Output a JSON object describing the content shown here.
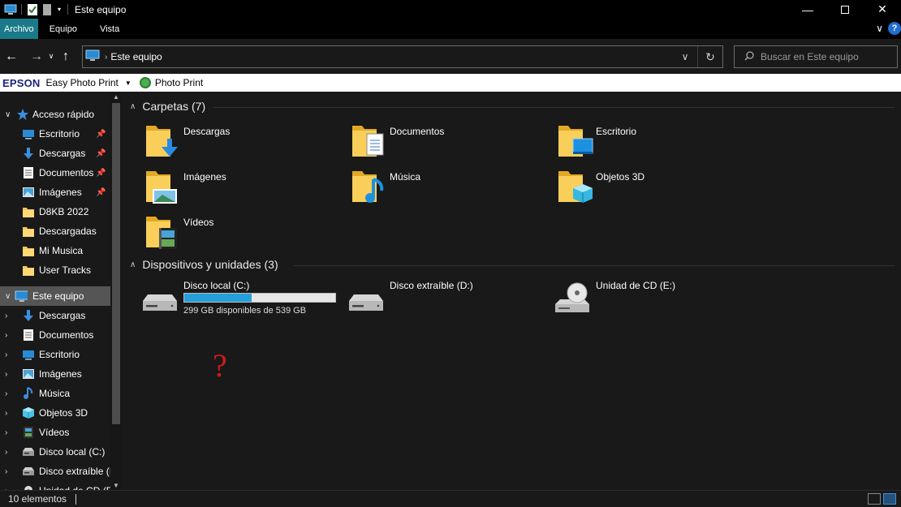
{
  "window": {
    "title": "Este equipo",
    "minimize_icon": "minimize-icon",
    "maximize_icon": "maximize-icon",
    "close_icon": "close-icon"
  },
  "ribbon": {
    "tabs": [
      {
        "label": "Archivo",
        "active": true
      },
      {
        "label": "Equipo",
        "active": false
      },
      {
        "label": "Vista",
        "active": false
      }
    ],
    "help_label": "?"
  },
  "nav": {
    "address_text": "Este equipo",
    "search_placeholder": "Buscar en Este equipo"
  },
  "epson": {
    "logo": "EPSON",
    "app": "Easy Photo Print",
    "photo_print": "Photo Print"
  },
  "sidebar": {
    "quick_access": "Acceso rápido",
    "quick_items": [
      {
        "label": "Escritorio",
        "icon": "desktop-icon",
        "pinned": true
      },
      {
        "label": "Descargas",
        "icon": "download-icon",
        "pinned": true
      },
      {
        "label": "Documentos",
        "icon": "document-icon",
        "pinned": true
      },
      {
        "label": "Imágenes",
        "icon": "pictures-icon",
        "pinned": true
      },
      {
        "label": "D8KB 2022",
        "icon": "folder-icon",
        "pinned": false
      },
      {
        "label": "Descargadas",
        "icon": "folder-icon",
        "pinned": false
      },
      {
        "label": "Mi Musica",
        "icon": "folder-icon",
        "pinned": false
      },
      {
        "label": "User Tracks",
        "icon": "folder-icon",
        "pinned": false
      }
    ],
    "this_pc": "Este equipo",
    "pc_items": [
      {
        "label": "Descargas",
        "icon": "download-icon"
      },
      {
        "label": "Documentos",
        "icon": "document-icon"
      },
      {
        "label": "Escritorio",
        "icon": "desktop-icon"
      },
      {
        "label": "Imágenes",
        "icon": "pictures-icon"
      },
      {
        "label": "Música",
        "icon": "music-icon"
      },
      {
        "label": "Objetos 3D",
        "icon": "3d-objects-icon"
      },
      {
        "label": "Vídeos",
        "icon": "videos-icon"
      },
      {
        "label": "Disco local (C:)",
        "icon": "drive-icon"
      },
      {
        "label": "Disco extraíble (I",
        "icon": "drive-icon"
      },
      {
        "label": "Unidad de CD (E",
        "icon": "cd-drive-icon"
      }
    ]
  },
  "content": {
    "folders_header": "Carpetas (7)",
    "folders": [
      {
        "label": "Descargas",
        "icon": "download-icon"
      },
      {
        "label": "Documentos",
        "icon": "document-icon"
      },
      {
        "label": "Escritorio",
        "icon": "desktop-icon"
      },
      {
        "label": "Imágenes",
        "icon": "pictures-icon"
      },
      {
        "label": "Música",
        "icon": "music-icon"
      },
      {
        "label": "Objetos 3D",
        "icon": "3d-objects-icon"
      },
      {
        "label": "Vídeos",
        "icon": "videos-icon"
      }
    ],
    "devices_header": "Dispositivos y unidades (3)",
    "drives": [
      {
        "label": "Disco local (C:)",
        "free_text": "299 GB disponibles de 539 GB",
        "used_fraction": 0.445
      },
      {
        "label": "Disco extraíble (D:)"
      },
      {
        "label": "Unidad de CD (E:)"
      }
    ],
    "annotation": "?"
  },
  "status": {
    "count": "10 elementos"
  },
  "colors": {
    "accent": "#1a7a8a",
    "drive_fill": "#26a0da",
    "annotation": "#d11a1a"
  }
}
